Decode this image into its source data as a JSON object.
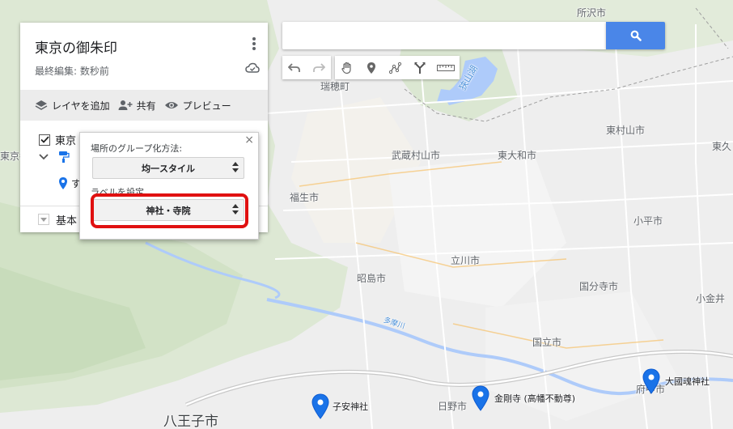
{
  "map": {
    "cities": [
      {
        "name": "所沢市",
        "cls": ""
      },
      {
        "name": "瑞穂町",
        "cls": ""
      },
      {
        "name": "狭山湖",
        "cls": "water"
      },
      {
        "name": "東村山市",
        "cls": ""
      },
      {
        "name": "東久",
        "cls": ""
      },
      {
        "name": "武蔵村山市",
        "cls": ""
      },
      {
        "name": "東大和市",
        "cls": ""
      },
      {
        "name": "東京都",
        "cls": ""
      },
      {
        "name": "福生市",
        "cls": ""
      },
      {
        "name": "小平市",
        "cls": ""
      },
      {
        "name": "立川市",
        "cls": ""
      },
      {
        "name": "昭島市",
        "cls": ""
      },
      {
        "name": "国分寺市",
        "cls": ""
      },
      {
        "name": "小金井",
        "cls": ""
      },
      {
        "name": "多摩川",
        "cls": "river"
      },
      {
        "name": "国立市",
        "cls": ""
      },
      {
        "name": "日野市",
        "cls": ""
      },
      {
        "name": "府中市",
        "cls": ""
      },
      {
        "name": "八王子市",
        "cls": "big"
      }
    ],
    "markers": [
      {
        "label": "子安神社"
      },
      {
        "label": "金剛寺 (高幡不動尊)"
      },
      {
        "label": "大國魂神社"
      }
    ],
    "marker_color": "#1a73e8"
  },
  "search": {
    "placeholder": "",
    "value": ""
  },
  "toolbar": {
    "icons": [
      "undo-icon",
      "redo-icon",
      "hand-icon",
      "add-marker-icon",
      "draw-line-icon",
      "directions-icon",
      "ruler-icon"
    ]
  },
  "panel": {
    "title": "東京の御朱印",
    "last_edit": "最終編集: 数秒前",
    "actions": {
      "add_layer": "レイヤを追加",
      "share": "共有",
      "preview": "プレビュー"
    },
    "layer_name": "東京",
    "pin_row_label": "す",
    "base_map_label": "基本"
  },
  "popup": {
    "close": "×",
    "group_label": "場所のグループ化方法:",
    "group_value": "均一スタイル",
    "label_label": "ラベルを設定",
    "label_value": "神社・寺院"
  },
  "colors": {
    "accent": "#4a86e8",
    "highlight": "#e01010"
  }
}
